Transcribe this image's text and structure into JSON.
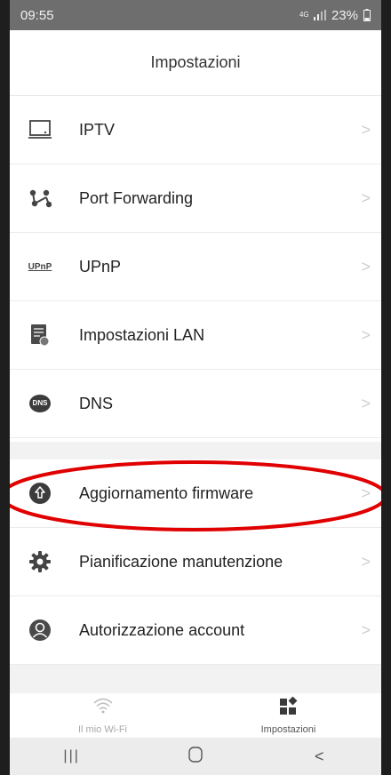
{
  "status_bar": {
    "time": "09:55",
    "network": "4G",
    "battery": "23%"
  },
  "header": {
    "title": "Impostazioni"
  },
  "menu_group_1": [
    {
      "label": "IPTV",
      "icon": "tv-icon"
    },
    {
      "label": "Port Forwarding",
      "icon": "port-forwarding-icon"
    },
    {
      "label": "UPnP",
      "icon": "upnp-icon"
    },
    {
      "label": "Impostazioni LAN",
      "icon": "lan-settings-icon"
    },
    {
      "label": "DNS",
      "icon": "dns-icon"
    }
  ],
  "menu_group_2": [
    {
      "label": "Aggiornamento firmware",
      "icon": "firmware-upgrade-icon"
    },
    {
      "label": "Pianificazione manutenzione",
      "icon": "gear-icon"
    },
    {
      "label": "Autorizzazione account",
      "icon": "account-icon"
    }
  ],
  "chevron_glyph": ">",
  "upnp_icon_text": "UPnP",
  "dns_icon_text": "DNS",
  "tabbar": {
    "tabs": [
      {
        "label": "Il mio Wi-Fi",
        "icon": "wifi-icon",
        "active": false
      },
      {
        "label": "Impostazioni",
        "icon": "settings-grid-icon",
        "active": true
      }
    ]
  },
  "nav_bar": {
    "recents": "|||",
    "home": "○",
    "back": "<"
  },
  "colors": {
    "accent": "#333333",
    "highlight_annotation": "#e00000",
    "status_bar_bg": "#6e6e6e"
  }
}
